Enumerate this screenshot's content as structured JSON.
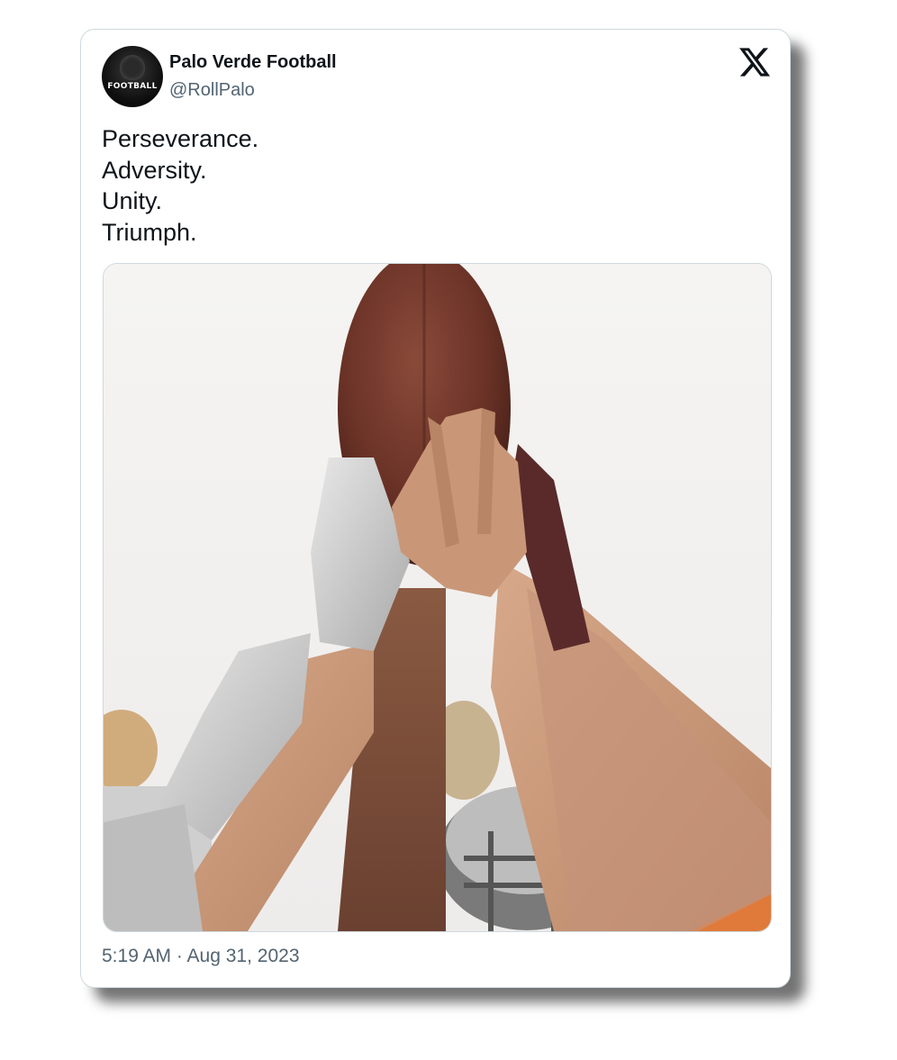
{
  "author": {
    "display_name": "Palo Verde Football",
    "handle": "@RollPalo",
    "avatar_text": "FOOTBALL"
  },
  "brand": {
    "logo_icon": "x-logo-icon"
  },
  "tweet": {
    "lines": [
      "Perseverance.",
      "Adversity.",
      "Unity.",
      "Triumph."
    ]
  },
  "media": {
    "icon": "football-hands-photo"
  },
  "meta": {
    "timestamp": "5:19 AM · Aug 31, 2023"
  },
  "colors": {
    "text_primary": "#0f1419",
    "text_secondary": "#536471",
    "border": "#cfd9de"
  }
}
